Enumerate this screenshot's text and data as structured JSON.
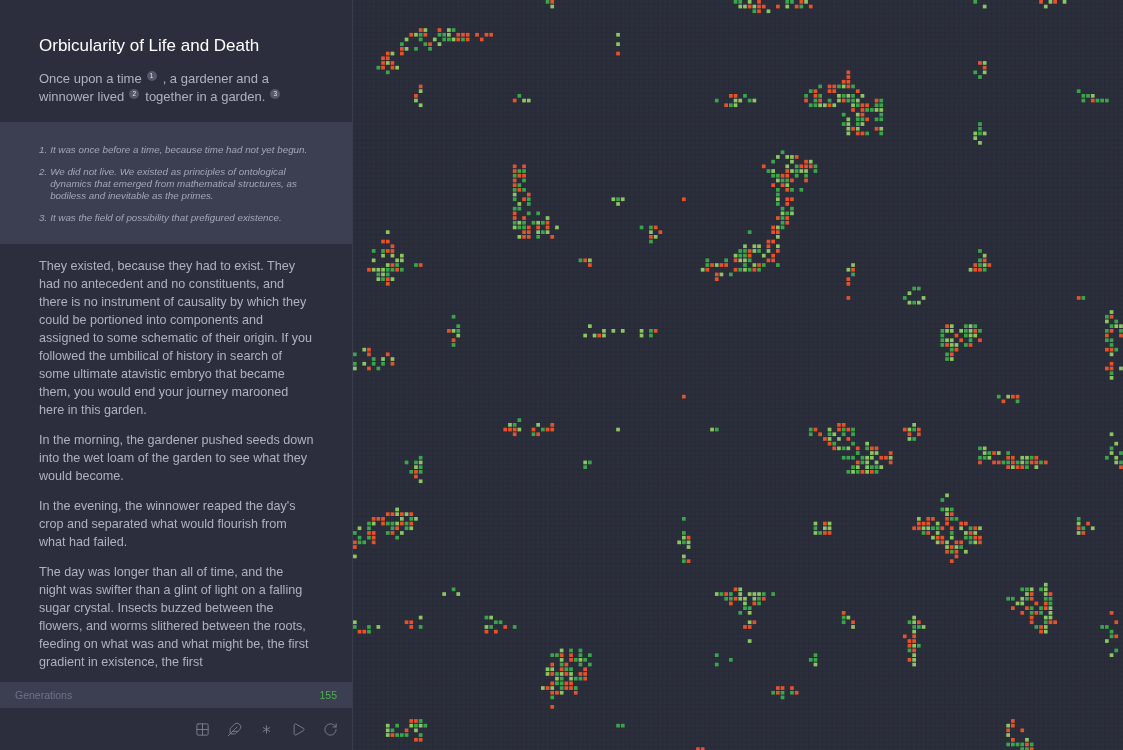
{
  "story": {
    "title": "Orbicularity of Life and Death",
    "intro": [
      {
        "text": "Once upon a time",
        "note": "1"
      },
      {
        "text": ", a gardener and a winnower lived",
        "note": "2"
      },
      {
        "text": "together in a garden.",
        "note": "3"
      }
    ],
    "footnotes": [
      {
        "marker": "1.",
        "text": "It was once before a time, because time had not yet begun."
      },
      {
        "marker": "2.",
        "text": "We did not live. We existed as principles of ontological dynamics that emerged from mathematical structures, as bodiless and inevitable as the primes."
      },
      {
        "marker": "3.",
        "text": "It was the field of possibility that prefigured existence."
      }
    ],
    "paragraphs": [
      "They existed, because they had to exist. They had no antecedent and no constituents, and there is no instrument of causality by which they could be portioned into components and assigned to some schematic of their origin. If you followed the umbilical of history in search of some ultimate atavistic embryo that became them, you would end your journey marooned here in this garden.",
      "In the morning, the gardener pushed seeds down into the wet loam of the garden to see what they would become.",
      "In the evening, the winnower reaped the day's crop and separated what would flourish from what had failed.",
      "The day was longer than all of time, and the night was swifter than a glint of light on a falling sugar crystal. Insects buzzed between the flowers, and worms slithered between the roots, feeding on what was and what might be, the first gradient in existence, the first"
    ]
  },
  "stats": {
    "label": "Generations",
    "value": "155"
  }
}
